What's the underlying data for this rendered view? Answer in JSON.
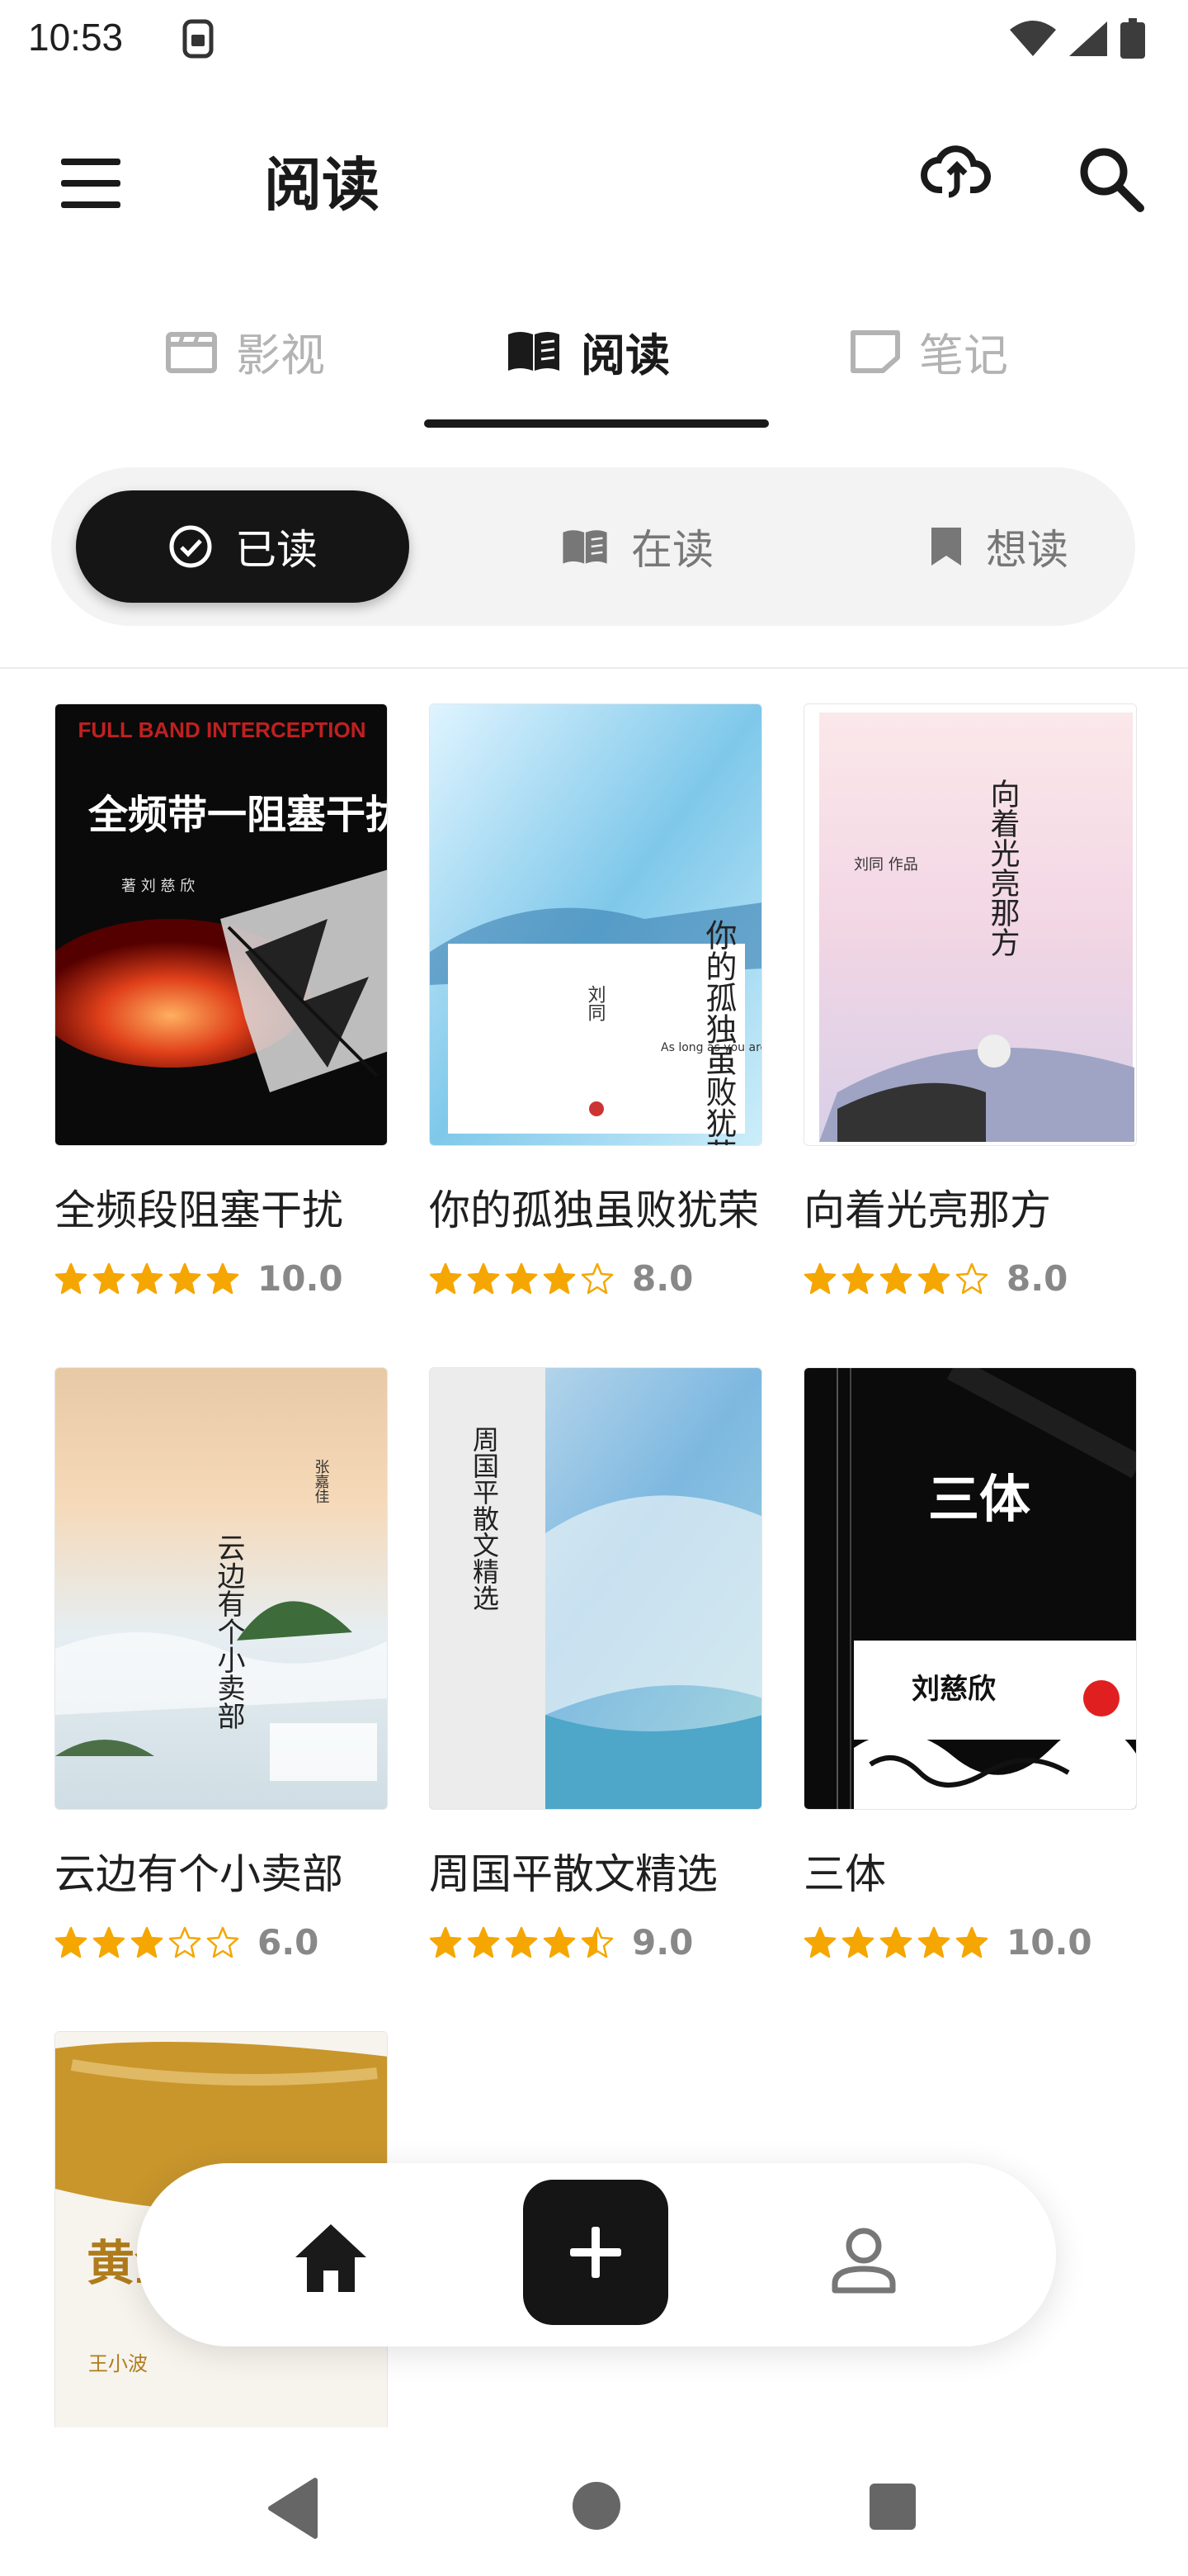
{
  "status": {
    "time": "10:53"
  },
  "appbar": {
    "title": "阅读"
  },
  "tabs": [
    {
      "label": "影视",
      "active": false
    },
    {
      "label": "阅读",
      "active": true
    },
    {
      "label": "笔记",
      "active": false
    }
  ],
  "filters": [
    {
      "label": "已读",
      "active": true
    },
    {
      "label": "在读",
      "active": false
    },
    {
      "label": "想读",
      "active": false
    }
  ],
  "books": [
    {
      "title": "全频段阻塞干扰",
      "rating": "10.0",
      "stars": 5
    },
    {
      "title": "你的孤独虽败犹荣",
      "rating": "8.0",
      "stars": 4
    },
    {
      "title": "向着光亮那方",
      "rating": "8.0",
      "stars": 4
    },
    {
      "title": "云边有个小卖部",
      "rating": "6.0",
      "stars": 3
    },
    {
      "title": "周国平散文精选",
      "rating": "9.0",
      "stars": 4.5
    },
    {
      "title": "三体",
      "rating": "10.0",
      "stars": 5
    },
    {
      "title": "黄金时代",
      "rating": "",
      "stars": 0
    }
  ],
  "covers": {
    "book1": {
      "title": "全频带一阻塞干扰",
      "en": "FULL BAND INTERCEPTION",
      "author": "著 刘 慈 欣"
    },
    "book2": {
      "title": "你的孤独虽败犹荣",
      "author": "刘同",
      "en": "As long as you are here"
    },
    "book3": {
      "title": "向着光亮那方",
      "author": "刘同 作品"
    },
    "book4": {
      "title": "云边有个小卖部",
      "author": "张嘉佳"
    },
    "book5": {
      "title": "周国平散文精选"
    },
    "book6": {
      "title": "三体",
      "author": "刘慈欣"
    },
    "book7": {
      "title": "黄金时代",
      "author": "王小波"
    }
  }
}
